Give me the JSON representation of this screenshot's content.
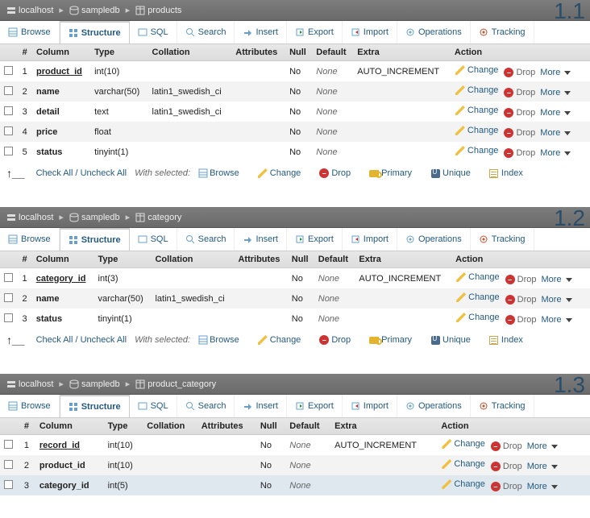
{
  "tabs": {
    "browse": "Browse",
    "structure": "Structure",
    "sql": "SQL",
    "search": "Search",
    "insert": "Insert",
    "export": "Export",
    "import": "Import",
    "operations": "Operations",
    "tracking": "Tracking"
  },
  "th": {
    "num": "#",
    "column": "Column",
    "type": "Type",
    "collation": "Collation",
    "attributes": "Attributes",
    "null": "Null",
    "default": "Default",
    "extra": "Extra",
    "action": "Action"
  },
  "act": {
    "change": "Change",
    "drop": "Drop",
    "more": "More"
  },
  "footer": {
    "check": "Check All / Uncheck All",
    "with": "With selected:",
    "browse": "Browse",
    "change": "Change",
    "drop": "Drop",
    "primary": "Primary",
    "unique": "Unique",
    "index": "Index"
  },
  "none_label": "None",
  "panels": [
    {
      "step": "1.1",
      "breadcrumb": [
        "localhost",
        "sampledb",
        "products"
      ],
      "columns": [
        {
          "num": "1",
          "name": "product_id",
          "pk": true,
          "type": "int(10)",
          "collation": "",
          "attrs": "",
          "null": "No",
          "default": "None",
          "extra": "AUTO_INCREMENT"
        },
        {
          "num": "2",
          "name": "name",
          "pk": false,
          "type": "varchar(50)",
          "collation": "latin1_swedish_ci",
          "attrs": "",
          "null": "No",
          "default": "None",
          "extra": ""
        },
        {
          "num": "3",
          "name": "detail",
          "pk": false,
          "type": "text",
          "collation": "latin1_swedish_ci",
          "attrs": "",
          "null": "No",
          "default": "None",
          "extra": ""
        },
        {
          "num": "4",
          "name": "price",
          "pk": false,
          "type": "float",
          "collation": "",
          "attrs": "",
          "null": "No",
          "default": "None",
          "extra": ""
        },
        {
          "num": "5",
          "name": "status",
          "pk": false,
          "type": "tinyint(1)",
          "collation": "",
          "attrs": "",
          "null": "No",
          "default": "None",
          "extra": ""
        }
      ],
      "show_footer": true
    },
    {
      "step": "1.2",
      "breadcrumb": [
        "localhost",
        "sampledb",
        "category"
      ],
      "columns": [
        {
          "num": "1",
          "name": "category_id",
          "pk": true,
          "type": "int(3)",
          "collation": "",
          "attrs": "",
          "null": "No",
          "default": "None",
          "extra": "AUTO_INCREMENT"
        },
        {
          "num": "2",
          "name": "name",
          "pk": false,
          "type": "varchar(50)",
          "collation": "latin1_swedish_ci",
          "attrs": "",
          "null": "No",
          "default": "None",
          "extra": ""
        },
        {
          "num": "3",
          "name": "status",
          "pk": false,
          "type": "tinyint(1)",
          "collation": "",
          "attrs": "",
          "null": "No",
          "default": "None",
          "extra": ""
        }
      ],
      "show_footer": true
    },
    {
      "step": "1.3",
      "breadcrumb": [
        "localhost",
        "sampledb",
        "product_category"
      ],
      "columns": [
        {
          "num": "1",
          "name": "record_id",
          "pk": true,
          "type": "int(10)",
          "collation": "",
          "attrs": "",
          "null": "No",
          "default": "None",
          "extra": "AUTO_INCREMENT"
        },
        {
          "num": "2",
          "name": "product_id",
          "pk": false,
          "type": "int(10)",
          "collation": "",
          "attrs": "",
          "null": "No",
          "default": "None",
          "extra": ""
        },
        {
          "num": "3",
          "name": "category_id",
          "pk": false,
          "type": "int(5)",
          "collation": "",
          "attrs": "",
          "null": "No",
          "default": "None",
          "extra": "",
          "sel": true
        }
      ],
      "show_footer": false
    }
  ]
}
